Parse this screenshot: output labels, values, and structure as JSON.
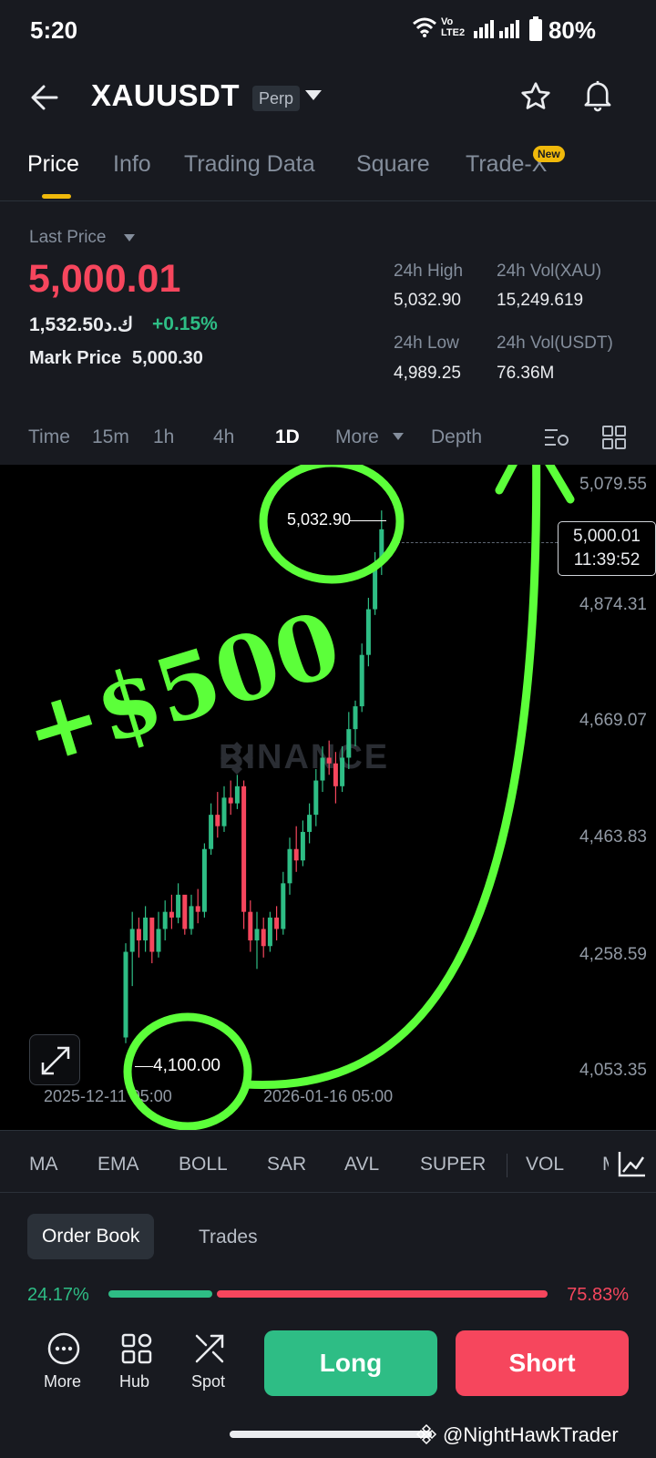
{
  "status_bar": {
    "time": "5:20",
    "battery": "80%",
    "network": "Vo LTE2"
  },
  "header": {
    "title": "XAUUSDT",
    "contract_type": "Perp"
  },
  "tabs": [
    {
      "label": "Price",
      "active": true
    },
    {
      "label": "Info"
    },
    {
      "label": "Trading Data"
    },
    {
      "label": "Square"
    },
    {
      "label": "Trade-X",
      "badge": "New"
    }
  ],
  "price": {
    "last_price_label": "Last Price",
    "last_price": "5,000.01",
    "local_price": "1,532.50ك.د",
    "change": "+0.15%",
    "mark_price_label": "Mark Price",
    "mark_price": "5,000.30",
    "high_label": "24h High",
    "high": "5,032.90",
    "vol_xau_label": "24h Vol(XAU)",
    "vol_xau": "15,249.619",
    "low_label": "24h Low",
    "low": "4,989.25",
    "vol_usdt_label": "24h Vol(USDT)",
    "vol_usdt": "76.36M"
  },
  "intervals": {
    "items": [
      "Time",
      "15m",
      "1h",
      "4h",
      "1D",
      "More",
      "Depth"
    ],
    "active": "1D"
  },
  "chart": {
    "watermark": "BINANCE",
    "y_ticks": [
      "5,079.55",
      "4,874.31",
      "4,669.07",
      "4,463.83",
      "4,258.59",
      "4,053.35"
    ],
    "x_ticks": [
      "2025-12-11 05:00",
      "2026-01-16 05:00"
    ],
    "current_price": "5,000.01",
    "countdown": "11:39:52",
    "high_marker": "5,032.90",
    "low_marker": "4,100.00",
    "annotation": "+$500",
    "colors": {
      "up": "#2ebd85",
      "down": "#f6465d",
      "annotation": "#5cff3a"
    }
  },
  "indicators": [
    "MA",
    "EMA",
    "BOLL",
    "SAR",
    "AVL",
    "SUPER",
    "VOL",
    "M"
  ],
  "orderbook": {
    "tab_active": "Order Book",
    "tab_other": "Trades",
    "bid_pct": "24.17%",
    "ask_pct": "75.83%",
    "bid_ratio": 0.2417
  },
  "bottom": {
    "more": "More",
    "hub": "Hub",
    "spot": "Spot",
    "long": "Long",
    "short": "Short"
  },
  "watermark_user": "@NightHawkTrader",
  "colors": {
    "accent": "#f0b90b",
    "up": "#2ebd85",
    "down": "#f6465d",
    "bg": "#181a20"
  }
}
